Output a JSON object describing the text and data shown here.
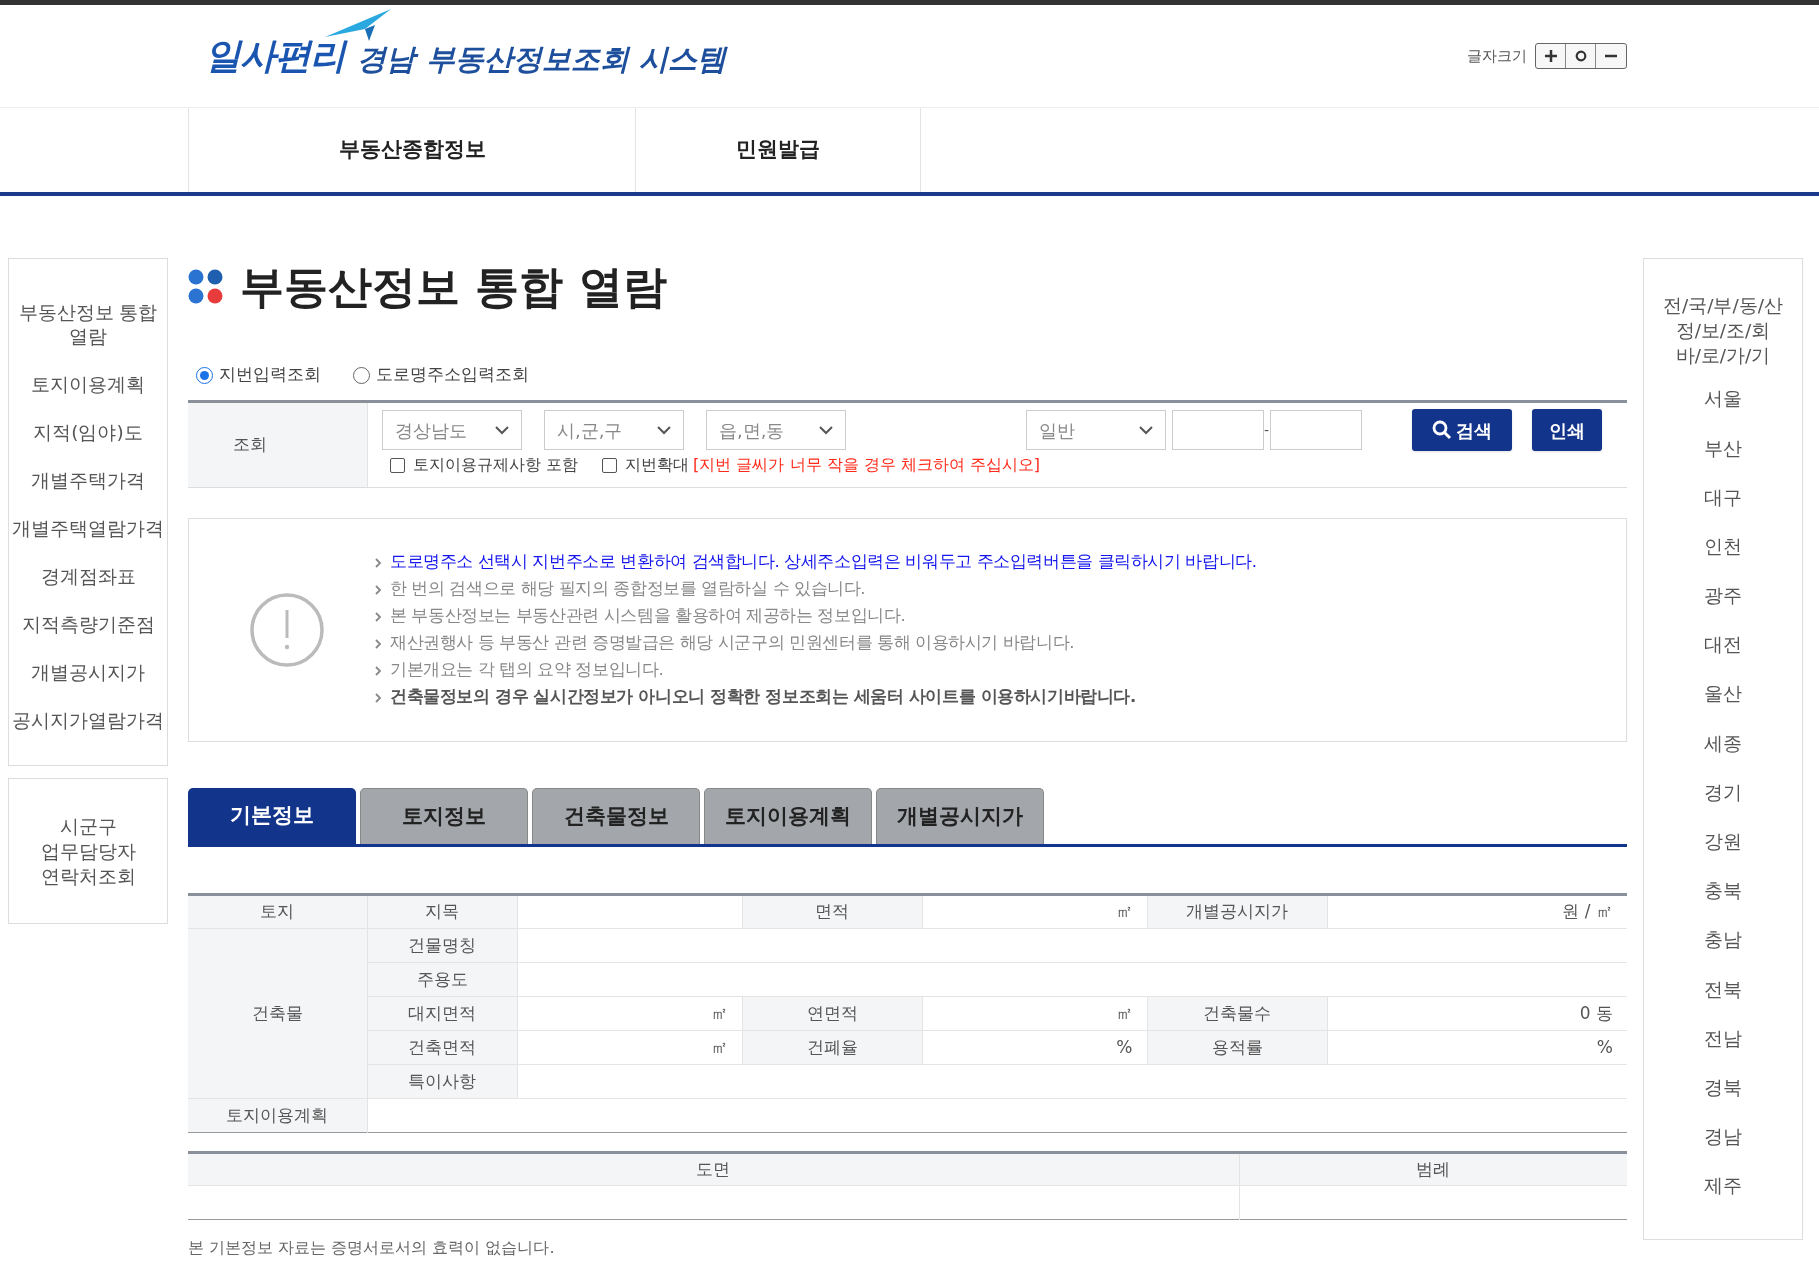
{
  "header": {
    "logo_text": "일사편리",
    "system_title": "경남 부동산정보조회 시스템",
    "font_size_label": "글자크기"
  },
  "nav": [
    {
      "label": "부동산종합정보"
    },
    {
      "label": "민원발급"
    }
  ],
  "sidebar": {
    "items": [
      {
        "lines": [
          "부동산정보 통합",
          "열람"
        ]
      },
      {
        "lines": [
          "토지이용계획"
        ]
      },
      {
        "lines": [
          "지적(임야)도"
        ]
      },
      {
        "lines": [
          "개별주택가격"
        ]
      },
      {
        "lines": [
          "개별주택열람가격"
        ]
      },
      {
        "lines": [
          "경계점좌표"
        ]
      },
      {
        "lines": [
          "지적측량기준점"
        ]
      },
      {
        "lines": [
          "개별공시지가"
        ]
      },
      {
        "lines": [
          "공시지가열람가격"
        ]
      }
    ],
    "contact": {
      "lines": [
        "시군구",
        "업무담당자",
        "연락처조회"
      ]
    }
  },
  "page_title": "부동산정보 통합 열람",
  "search": {
    "modes": [
      {
        "label": "지번입력조회",
        "selected": true
      },
      {
        "label": "도로명주소입력조회",
        "selected": false
      }
    ],
    "label": "조회",
    "selects": [
      {
        "value": "경상남도"
      },
      {
        "value": "시,군,구"
      },
      {
        "value": "읍,면,동"
      }
    ],
    "type_select": {
      "value": "일반"
    },
    "separator": "-",
    "options": [
      {
        "label": "토지이용규제사항 포함",
        "checked": false
      },
      {
        "label": "지번확대",
        "checked": false
      }
    ],
    "warning": "[지번 글씨가 너무 작을 경우 체크하여 주십시오]",
    "search_button": "검색",
    "print_button": "인쇄"
  },
  "notices": [
    {
      "text": "도로명주소 선택시 지번주소로 변환하여 검색합니다. 상세주소입력은 비워두고 주소입력버튼을 클릭하시기 바랍니다.",
      "kind": "highlight"
    },
    {
      "text": "한 번의 검색으로 해당 필지의 종합정보를 열람하실 수 있습니다.",
      "kind": "normal"
    },
    {
      "text": "본 부동산정보는 부동산관련 시스템을 활용하여 제공하는 정보입니다.",
      "kind": "normal"
    },
    {
      "text": "재산권행사 등 부동산 관련 증명발급은 해당 시군구의 민원센터를 통해 이용하시기 바랍니다.",
      "kind": "normal"
    },
    {
      "text": "기본개요는 각 탭의 요약 정보입니다.",
      "kind": "normal"
    },
    {
      "text": "건축물정보의 경우 실시간정보가 아니오니 정확한 정보조회는 세움터 사이트를 이용하시기바랍니다.",
      "kind": "strong"
    }
  ],
  "tabs": [
    {
      "label": "기본정보",
      "selected": true
    },
    {
      "label": "토지정보",
      "selected": false
    },
    {
      "label": "건축물정보",
      "selected": false
    },
    {
      "label": "토지이용계획",
      "selected": false
    },
    {
      "label": "개별공시지가",
      "selected": false
    }
  ],
  "info_table": {
    "rows": [
      [
        {
          "kind": "head",
          "text": "토지"
        },
        {
          "kind": "head",
          "text": "지목"
        },
        {
          "kind": "value"
        },
        {
          "kind": "head",
          "text": "면적"
        },
        {
          "kind": "value",
          "text": "㎡"
        },
        {
          "kind": "head",
          "text": "개별공시지가"
        },
        {
          "kind": "value",
          "text": "원 / ㎡"
        }
      ],
      [
        {
          "kind": "head",
          "text": "건축물",
          "rowspan": 5
        },
        {
          "kind": "head",
          "text": "건물명칭"
        },
        {
          "kind": "value"
        }
      ],
      [
        {
          "kind": "head",
          "text": "주용도"
        },
        {
          "kind": "value"
        }
      ],
      [
        {
          "kind": "head",
          "text": "대지면적"
        },
        {
          "kind": "value",
          "text": "㎡"
        },
        {
          "kind": "head",
          "text": "연면적"
        },
        {
          "kind": "value",
          "text": "㎡"
        },
        {
          "kind": "head",
          "text": "건축물수"
        },
        {
          "kind": "value",
          "text": "0 동"
        }
      ],
      [
        {
          "kind": "head",
          "text": "건축면적"
        },
        {
          "kind": "value",
          "text": "㎡"
        },
        {
          "kind": "head",
          "text": "건폐율"
        },
        {
          "kind": "value",
          "text": "%"
        },
        {
          "kind": "head",
          "text": "용적률"
        },
        {
          "kind": "value",
          "text": "%"
        }
      ],
      [
        {
          "kind": "head",
          "text": "특이사항"
        },
        {
          "kind": "value"
        }
      ],
      [
        {
          "kind": "head",
          "text": "토지이용계획"
        },
        {
          "kind": "value"
        }
      ]
    ]
  },
  "drawing_table": {
    "columns": [
      "도면",
      "범례"
    ]
  },
  "footnote": "본 기본정보 자료는 증명서로서의 효력이 없습니다.",
  "region_links": {
    "title_lines": [
      "전/국/부/동/산",
      "정/보/조/회",
      "바/로/가/기"
    ],
    "items": [
      "서울",
      "부산",
      "대구",
      "인천",
      "광주",
      "대전",
      "울산",
      "세종",
      "경기",
      "강원",
      "충북",
      "충남",
      "전북",
      "전남",
      "경북",
      "경남",
      "제주"
    ]
  }
}
